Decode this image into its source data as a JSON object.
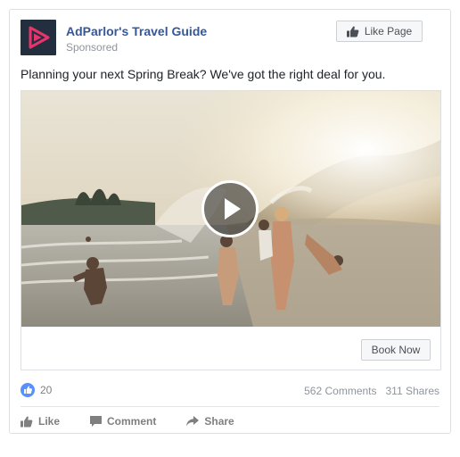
{
  "post": {
    "page_name": "AdParlor's Travel Guide",
    "sponsored_label": "Sponsored",
    "like_page_label": "Like Page",
    "text": "Planning your next Spring Break? We've got the right deal for you.",
    "cta_label": "Book Now"
  },
  "stats": {
    "like_count": "20",
    "comments": "562 Comments",
    "shares": "311 Shares"
  },
  "actions": {
    "like": "Like",
    "comment": "Comment",
    "share": "Share"
  },
  "icons": {
    "logo": "play-triangle-logo",
    "like_page": "thumbs-up-icon",
    "play": "play-icon",
    "reaction": "thumbs-up-icon",
    "comment": "speech-bubble-icon",
    "share": "share-arrow-icon"
  },
  "colors": {
    "link": "#365899",
    "logo_bg": "#232f3e",
    "logo_accent": "#e8336d",
    "like_blue": "#5890ff"
  }
}
